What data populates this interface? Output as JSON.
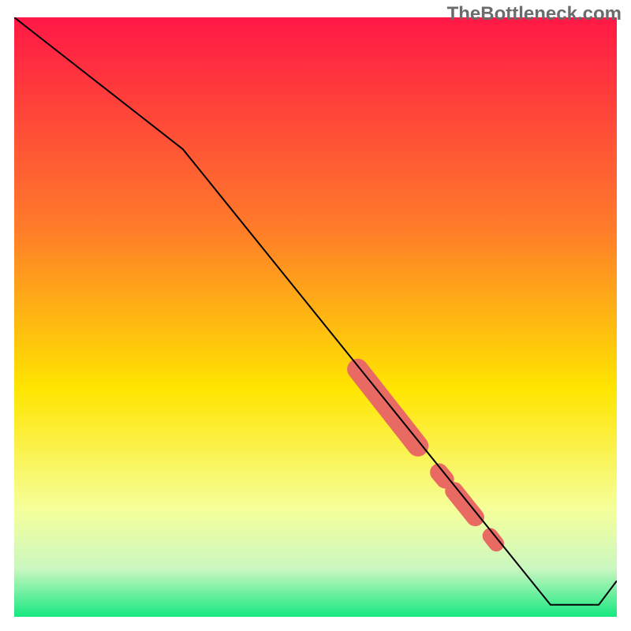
{
  "watermark": "TheBottleneck.com",
  "colors": {
    "top": "#ff1846",
    "upper_mid": "#ff7b2a",
    "mid": "#ffe500",
    "lower_mid": "#f6ff9a",
    "near_bottom": "#caf7c1",
    "bottom": "#17e880",
    "line": "#000000",
    "marker": "#e86a62"
  },
  "chart_data": {
    "type": "line",
    "title": "",
    "xlabel": "",
    "ylabel": "",
    "xlim": [
      0,
      100
    ],
    "ylim": [
      0,
      100
    ],
    "series": [
      {
        "name": "bottleneck-curve",
        "x": [
          0,
          28,
          89,
          97,
          100
        ],
        "y": [
          100,
          78,
          2,
          2,
          6
        ]
      }
    ],
    "markers": [
      {
        "name": "segment-a",
        "x0": 57,
        "y0": 41.3,
        "x1": 67,
        "y1": 28.5,
        "w": 3.5
      },
      {
        "name": "segment-b",
        "x0": 70.5,
        "y0": 24.1,
        "x1": 71.5,
        "y1": 22.9,
        "w": 3.0
      },
      {
        "name": "segment-c",
        "x0": 73,
        "y0": 21.0,
        "x1": 76.5,
        "y1": 16.6,
        "w": 3.0
      },
      {
        "name": "segment-d",
        "x0": 79,
        "y0": 13.5,
        "x1": 80,
        "y1": 12.2,
        "w": 2.6
      }
    ],
    "gradient_stops": [
      {
        "pct": 0,
        "keyref": "top"
      },
      {
        "pct": 35,
        "keyref": "upper_mid"
      },
      {
        "pct": 62,
        "keyref": "mid"
      },
      {
        "pct": 82,
        "keyref": "lower_mid"
      },
      {
        "pct": 92,
        "keyref": "near_bottom"
      },
      {
        "pct": 100,
        "keyref": "bottom"
      }
    ]
  }
}
